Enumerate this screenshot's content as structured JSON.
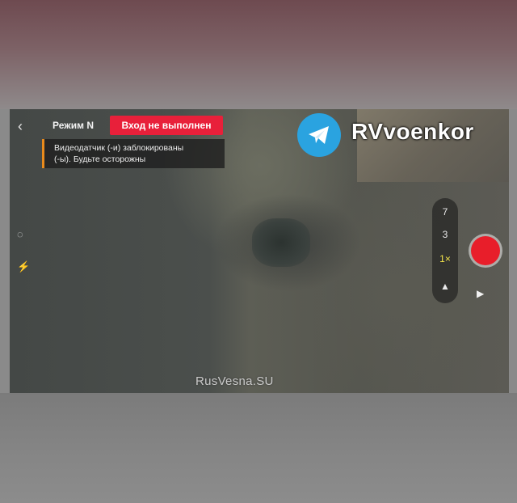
{
  "header": {
    "back_icon": "chevron-left-icon",
    "mode_label": "Режим N",
    "login_status": "Вход не выполнен"
  },
  "warning": {
    "line1": "Видеодатчик (-и) заблокированы",
    "line2": "(-ы). Будьте осторожны"
  },
  "channel": {
    "icon": "telegram-icon",
    "name": "RVvoenkor"
  },
  "zoom": {
    "levels": [
      "7",
      "3",
      "1×"
    ]
  },
  "watermark": "RusVesna.SU",
  "colors": {
    "login_badge": "#e8203a",
    "warning_accent": "#e98a1c",
    "telegram": "#2aa3e0",
    "record": "#e81e2a"
  }
}
